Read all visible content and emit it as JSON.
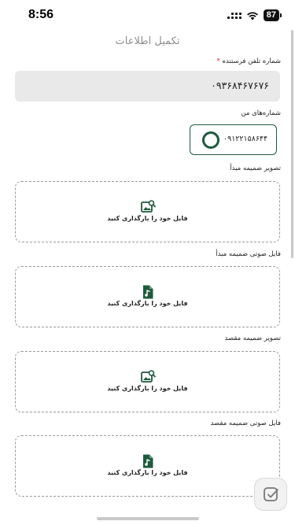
{
  "status_bar": {
    "time": "8:56",
    "battery": "87"
  },
  "header": {
    "title": "تکمیل اطلاعات"
  },
  "sender_phone": {
    "label": "شماره تلفن فرستنده",
    "required_mark": "*",
    "value": "۰۹۳۶۸۴۶۷۶۷۶"
  },
  "my_numbers": {
    "label": "شماره‌های من",
    "items": [
      {
        "number": "۰۹۱۲۲۱۵۸۶۴۴"
      }
    ]
  },
  "uploads": [
    {
      "label": "تصویر ضمیمه مبدأ",
      "text": "فایل خود را بارگذاری کنید",
      "icon": "image-upload-icon"
    },
    {
      "label": "فایل صوتی ضمیمه مبدأ",
      "text": "فایل خود را بارگذاری کنید",
      "icon": "audio-file-icon"
    },
    {
      "label": "تصویر ضمیمه مقصد",
      "text": "فایل خود را بارگذاری کنید",
      "icon": "image-upload-icon"
    },
    {
      "label": "فایل صوتی ضمیمه مقصد",
      "text": "فایل خود را بارگذاری کنید",
      "icon": "audio-file-icon"
    }
  ],
  "colors": {
    "accent": "#1f5a3d",
    "field_bg": "#e9e9e9",
    "required": "#d62d2d"
  }
}
